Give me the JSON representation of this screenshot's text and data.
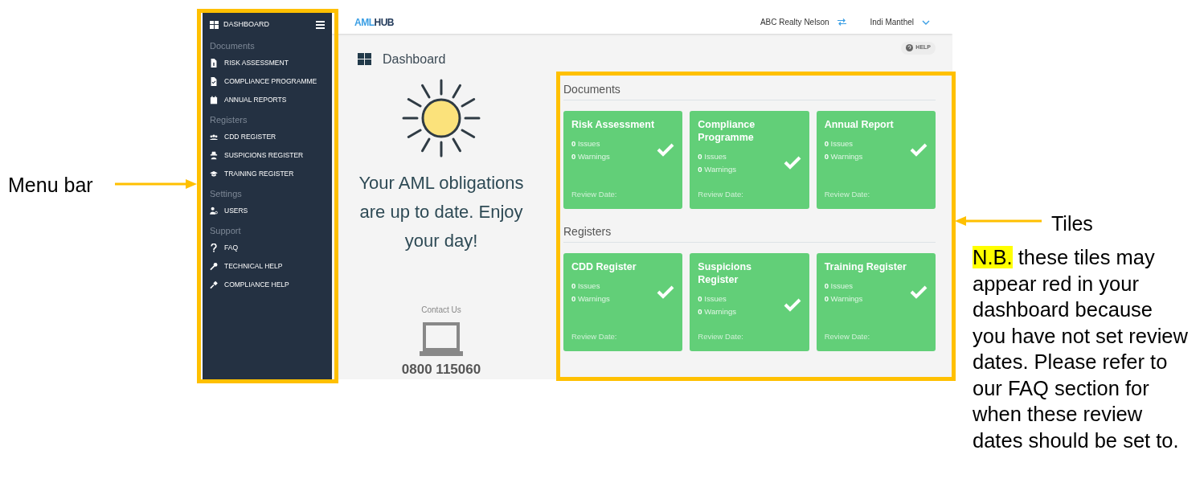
{
  "sidebar": {
    "header": {
      "label": "DASHBOARD"
    },
    "sections": [
      {
        "title": "Documents",
        "items": [
          {
            "label": "RISK ASSESSMENT"
          },
          {
            "label": "COMPLIANCE PROGRAMME"
          },
          {
            "label": "ANNUAL REPORTS"
          }
        ]
      },
      {
        "title": "Registers",
        "items": [
          {
            "label": "CDD REGISTER"
          },
          {
            "label": "SUSPICIONS REGISTER"
          },
          {
            "label": "TRAINING REGISTER"
          }
        ]
      },
      {
        "title": "Settings",
        "items": [
          {
            "label": "USERS"
          }
        ]
      },
      {
        "title": "Support",
        "items": [
          {
            "label": "FAQ"
          },
          {
            "label": "TECHNICAL HELP"
          },
          {
            "label": "COMPLIANCE HELP"
          }
        ]
      }
    ]
  },
  "topbar": {
    "logo_left": "AML",
    "logo_right": "HUB",
    "organisation": "ABC Realty Nelson",
    "user": "Indi Manthel"
  },
  "page": {
    "title": "Dashboard",
    "help": "HELP"
  },
  "status_panel": {
    "message": "Your AML obligations are up to date. Enjoy your day!",
    "contact_label": "Contact Us",
    "phone": "0800 115060"
  },
  "tile_sections": [
    {
      "title": "Documents",
      "tiles": [
        {
          "title": "Risk Assessment",
          "issues": "0",
          "issues_label": "Issues",
          "warnings": "0",
          "warnings_label": "Warnings",
          "review": "Review Date:",
          "complete": true
        },
        {
          "title": "Compliance Programme",
          "issues": "0",
          "issues_label": "Issues",
          "warnings": "0",
          "warnings_label": "Warnings",
          "review": "Review Date:",
          "complete": true
        },
        {
          "title": "Annual Report",
          "issues": "0",
          "issues_label": "Issues",
          "warnings": "0",
          "warnings_label": "Warnings",
          "review": "Review Date:",
          "complete": true
        }
      ]
    },
    {
      "title": "Registers",
      "tiles": [
        {
          "title": "CDD Register",
          "issues": "0",
          "issues_label": "Issues",
          "warnings": "0",
          "warnings_label": "Warnings",
          "review": "Review Date:",
          "complete": true
        },
        {
          "title": "Suspicions Register",
          "issues": "0",
          "issues_label": "Issues",
          "warnings": "0",
          "warnings_label": "Warnings",
          "review": "Review Date:",
          "complete": true
        },
        {
          "title": "Training Register",
          "issues": "0",
          "issues_label": "Issues",
          "warnings": "0",
          "warnings_label": "Warnings",
          "review": "Review Date:",
          "complete": true
        }
      ]
    }
  ],
  "annotations": {
    "menu_label": "Menu bar",
    "tiles_label": "Tiles",
    "note_highlight": "N.B.",
    "note": "these tiles may appear red in your dashboard because you have not set review dates. Please refer to our FAQ section for when these review dates should be set to."
  }
}
